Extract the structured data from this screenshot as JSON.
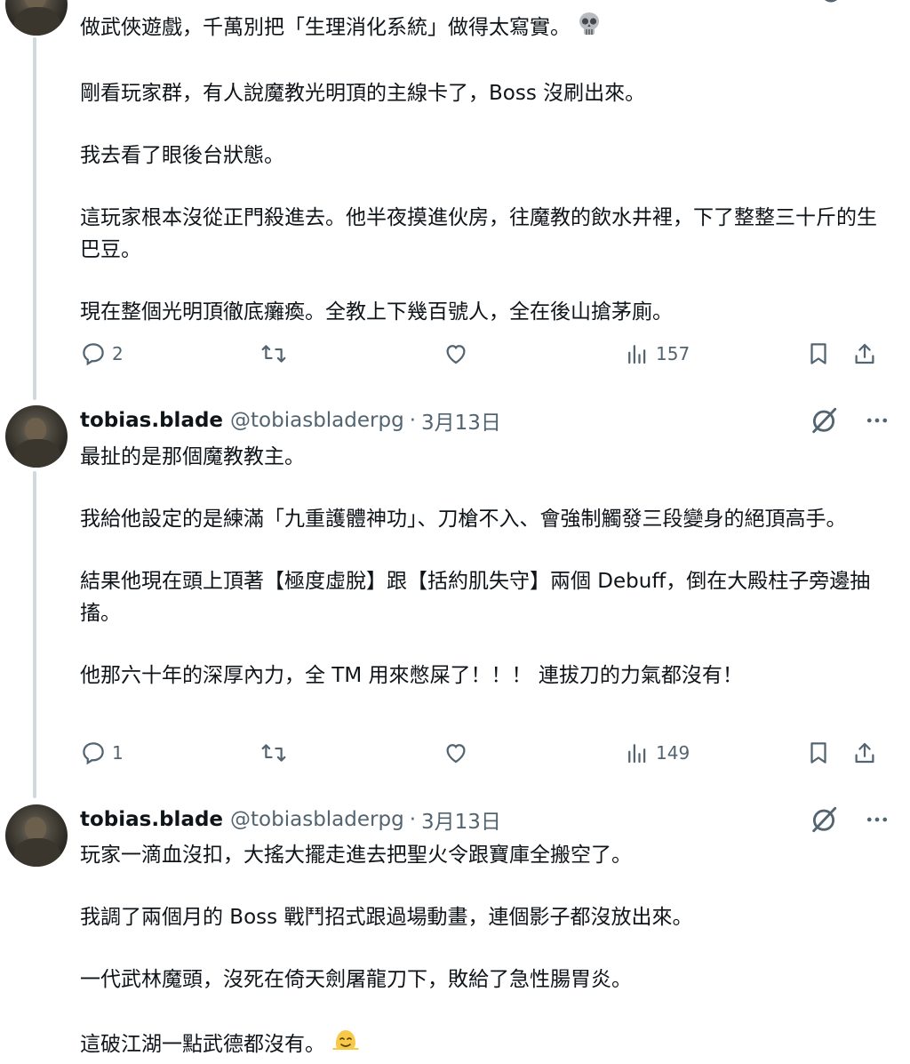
{
  "colors": {
    "text": "#0f1419",
    "secondary": "#536471",
    "thread_line": "#cfd9de",
    "background": "#ffffff"
  },
  "tweets": [
    {
      "author": {
        "name": "",
        "handle": "",
        "date": ""
      },
      "paragraphs": [
        "做武俠遊戲，千萬別把「生理消化系統」做得太寫實。",
        "剛看玩家群，有人說魔教光明頂的主線卡了，Boss 沒刷出來。",
        "我去看了眼後台狀態。",
        "這玩家根本沒從正門殺進去。他半夜摸進伙房，往魔教的飲水井裡，下了整整三十斤的生巴豆。",
        "現在整個光明頂徹底癱瘓。全教上下幾百號人，全在後山搶茅廁。"
      ],
      "trailing_emoji": "skull-emoji",
      "stats": {
        "replies": "2",
        "reposts": "",
        "likes": "",
        "views": "157"
      }
    },
    {
      "author": {
        "name": "tobias.blade",
        "handle": "@tobiasbladerpg",
        "date": "3月13日"
      },
      "paragraphs": [
        "最扯的是那個魔教教主。",
        "我給他設定的是練滿「九重護體神功」、刀槍不入、會強制觸發三段變身的絕頂高手。",
        "結果他現在頭上頂著【極度虛脫】跟【括約肌失守】兩個 Debuff，倒在大殿柱子旁邊抽搐。",
        "他那六十年的深厚內力，全 TM 用來憋屎了！！！ 連拔刀的力氣都沒有！"
      ],
      "stats": {
        "replies": "1",
        "reposts": "",
        "likes": "",
        "views": "149"
      }
    },
    {
      "author": {
        "name": "tobias.blade",
        "handle": "@tobiasbladerpg",
        "date": "3月13日"
      },
      "paragraphs": [
        "玩家一滴血沒扣，大搖大擺走進去把聖火令跟寶庫全搬空了。",
        "我調了兩個月的 Boss 戰鬥招式跟過場動畫，連個影子都沒放出來。",
        "一代武林魔頭，沒死在倚天劍屠龍刀下，敗給了急性腸胃炎。",
        "這破江湖一點武德都沒有。"
      ],
      "trailing_emoji": "melting-face-emoji"
    }
  ]
}
